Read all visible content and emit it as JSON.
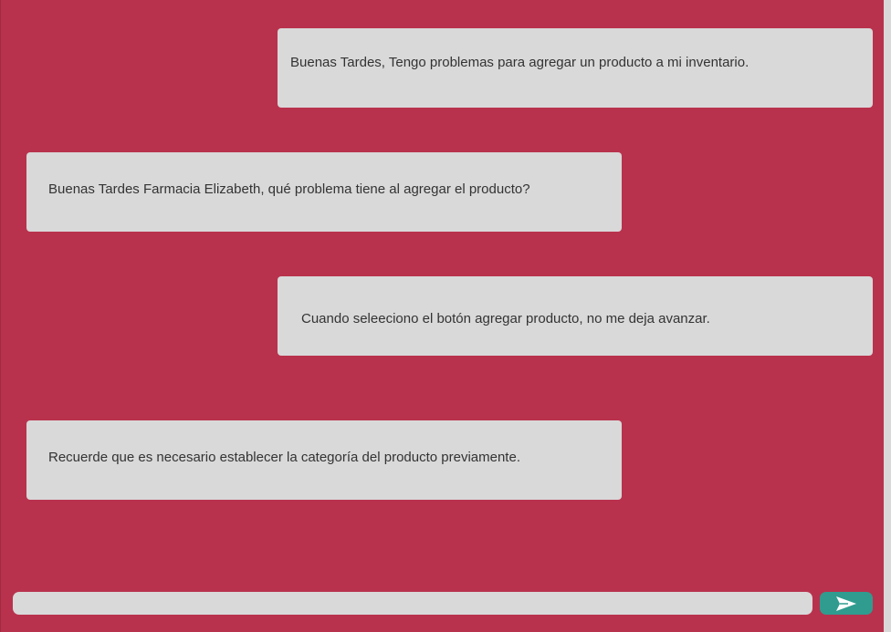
{
  "chat": {
    "messages": [
      {
        "sender": "user",
        "text": "Buenas Tardes, Tengo problemas para agregar un producto a mi inventario."
      },
      {
        "sender": "support",
        "text": "Buenas Tardes Farmacia Elizabeth, qué problema tiene al agregar el producto?"
      },
      {
        "sender": "user",
        "text": "Cuando seleeciono el botón agregar producto, no me deja avanzar."
      },
      {
        "sender": "support",
        "text": "Recuerde que es necesario establecer la categoría del producto previamente."
      }
    ]
  },
  "composer": {
    "input_value": "",
    "input_placeholder": "",
    "send_icon": "send-icon"
  },
  "colors": {
    "background": "#b8324d",
    "bubble": "#d9d9d9",
    "input": "#d9d9d9",
    "send_button": "#2f9c8f",
    "send_icon": "#ffffff"
  }
}
